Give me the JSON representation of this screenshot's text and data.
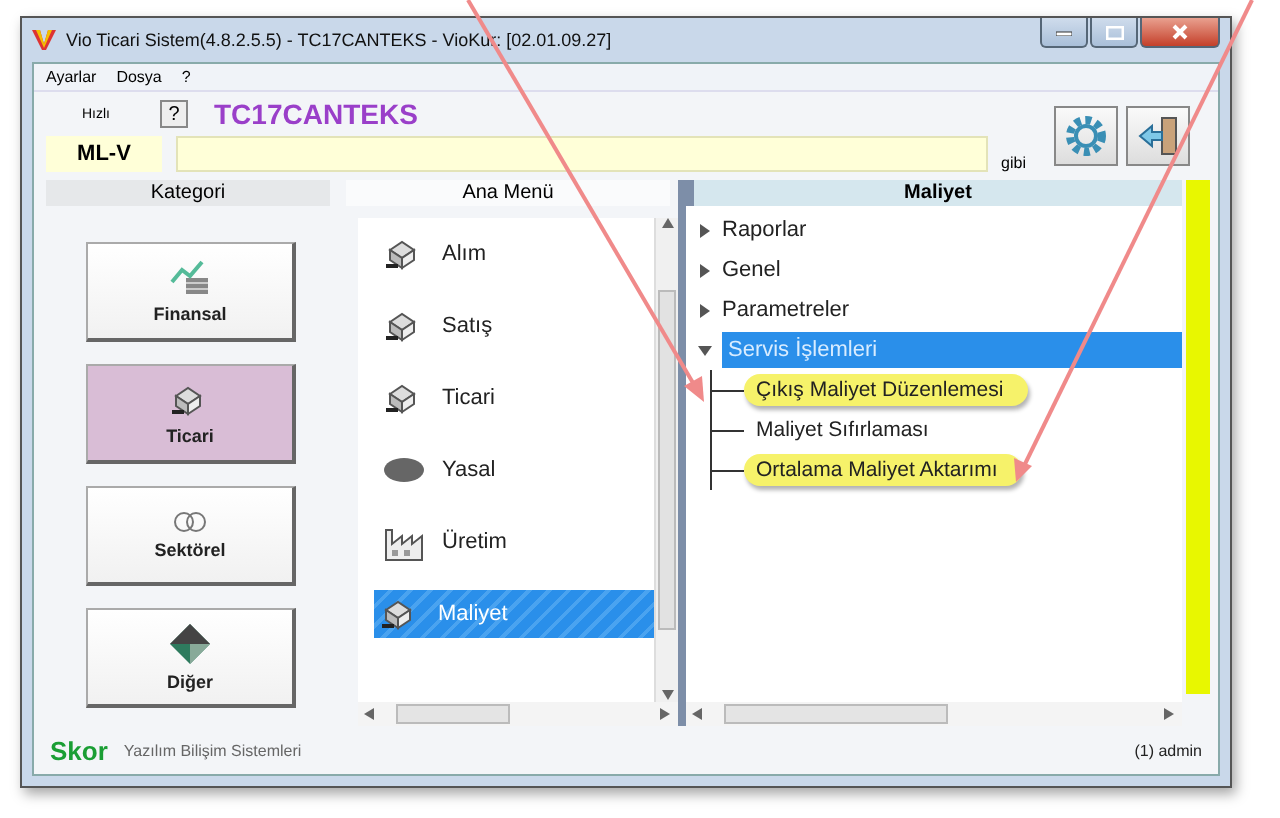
{
  "window": {
    "title": "Vio Ticari Sistem(4.8.2.5.5)  - TC17CANTEKS - VioKur: [02.01.09.27]"
  },
  "menu_bar": [
    "Ayarlar",
    "Dosya",
    "?"
  ],
  "toolbar": {
    "quick_label": "Hızlı",
    "help_button": "?",
    "company": "TC17CANTEKS",
    "code": "ML-V",
    "search_suffix": "gibi"
  },
  "categories": {
    "header": "Kategori",
    "items": [
      {
        "label": "Finansal",
        "selected": false
      },
      {
        "label": "Ticari",
        "selected": true
      },
      {
        "label": "Sektörel",
        "selected": false
      },
      {
        "label": "Diğer",
        "selected": false
      }
    ]
  },
  "main_menu": {
    "header": "Ana Menü",
    "items": [
      {
        "label": "Alım",
        "selected": false
      },
      {
        "label": "Satış",
        "selected": false
      },
      {
        "label": "Ticari",
        "selected": false
      },
      {
        "label": "Yasal",
        "selected": false
      },
      {
        "label": "Üretim",
        "selected": false
      },
      {
        "label": "Maliyet",
        "selected": true
      }
    ]
  },
  "tree": {
    "header": "Maliyet",
    "items": [
      {
        "label": "Raporlar",
        "expanded": false,
        "selected": false
      },
      {
        "label": "Genel",
        "expanded": false,
        "selected": false
      },
      {
        "label": "Parametreler",
        "expanded": false,
        "selected": false
      },
      {
        "label": "Servis İşlemleri",
        "expanded": true,
        "selected": true,
        "children": [
          {
            "label": "Çıkış Maliyet Düzenlemesi",
            "selected": false,
            "highlighted": true
          },
          {
            "label": "Maliyet Sıfırlaması",
            "selected": false,
            "highlighted": false
          },
          {
            "label": "Ortalama Maliyet Aktarımı",
            "selected": false,
            "highlighted": true
          }
        ]
      }
    ]
  },
  "status_bar": {
    "brand": "Skor",
    "company": "Yazılım Bilişim Sistemleri",
    "user": "(1) admin"
  }
}
